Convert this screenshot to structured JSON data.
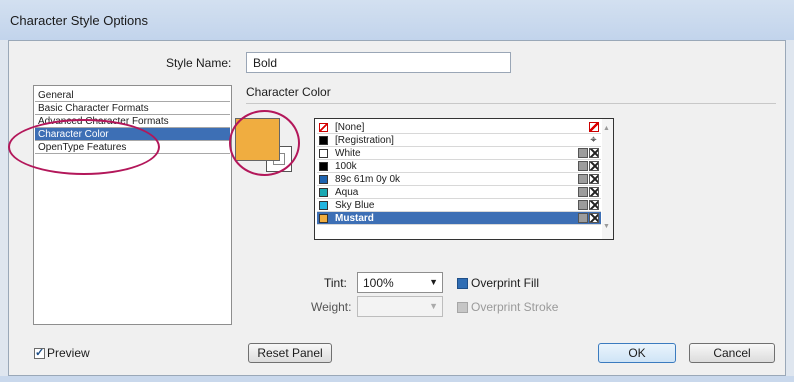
{
  "window": {
    "title": "Character Style Options"
  },
  "style_name": {
    "label": "Style Name:",
    "value": "Bold"
  },
  "sections": [
    {
      "label": "General"
    },
    {
      "label": "Basic Character Formats"
    },
    {
      "label": "Advanced Character Formats"
    },
    {
      "label": "Character Color",
      "selected": true
    },
    {
      "label": "OpenType Features"
    }
  ],
  "panel": {
    "title": "Character Color"
  },
  "fill": {
    "color": "#f0ad40"
  },
  "swatches": [
    {
      "name": "[None]",
      "color": "none",
      "icons": [
        "none-swatch-icon"
      ]
    },
    {
      "name": "[Registration]",
      "color": "#000000",
      "icons": [
        "registration-icon"
      ]
    },
    {
      "name": "White",
      "color": "#ffffff",
      "icons": [
        "color-mode-icon",
        "process-color-icon"
      ]
    },
    {
      "name": "100k",
      "color": "#000000",
      "icons": [
        "color-mode-icon",
        "process-color-icon"
      ]
    },
    {
      "name": "89c 61m 0y 0k",
      "color": "#1d63b0",
      "icons": [
        "color-mode-icon",
        "process-color-icon"
      ]
    },
    {
      "name": "Aqua",
      "color": "#1aa9b3",
      "icons": [
        "color-mode-icon",
        "process-color-icon"
      ]
    },
    {
      "name": "Sky Blue",
      "color": "#22b5e0",
      "icons": [
        "color-mode-icon",
        "process-color-icon"
      ]
    },
    {
      "name": "Mustard",
      "color": "#f0ad40",
      "icons": [
        "color-mode-icon",
        "process-color-icon"
      ],
      "selected": true
    }
  ],
  "tint": {
    "label": "Tint:",
    "value": "100%"
  },
  "weight": {
    "label": "Weight:",
    "value": ""
  },
  "overprint_fill": {
    "label": "Overprint Fill",
    "checked": true
  },
  "overprint_stroke": {
    "label": "Overprint Stroke",
    "checked": false,
    "disabled": true
  },
  "preview": {
    "label": "Preview",
    "checked": true
  },
  "buttons": {
    "reset": "Reset Panel",
    "ok": "OK",
    "cancel": "Cancel"
  },
  "colors": {
    "selection": "#3d6fb5",
    "annotation": "#b3175a"
  }
}
